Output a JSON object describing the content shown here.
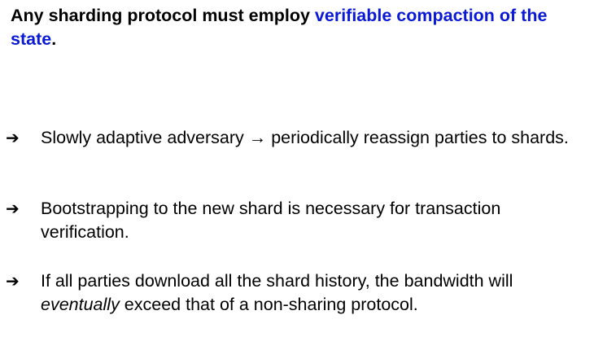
{
  "slide": {
    "heading": {
      "plain": "Any sharding protocol must employ ",
      "accent": "verifiable compaction of the state",
      "end": ".",
      "accent_color": "#0a19d6"
    },
    "bullet_icon": "right-arrow-icon",
    "bullet_glyph": "➔",
    "bullets": [
      {
        "text_before": "Slowly adaptive adversary → periodically reassign parties to shards.",
        "emphasis": "",
        "text_after": ""
      },
      {
        "text_before": "Bootstrapping to the new shard is necessary for transaction verification.",
        "emphasis": "",
        "text_after": ""
      },
      {
        "text_before": "If all parties download all the shard history, the bandwidth will ",
        "emphasis": "eventually",
        "text_after": " exceed that of a non-sharing protocol."
      }
    ]
  }
}
